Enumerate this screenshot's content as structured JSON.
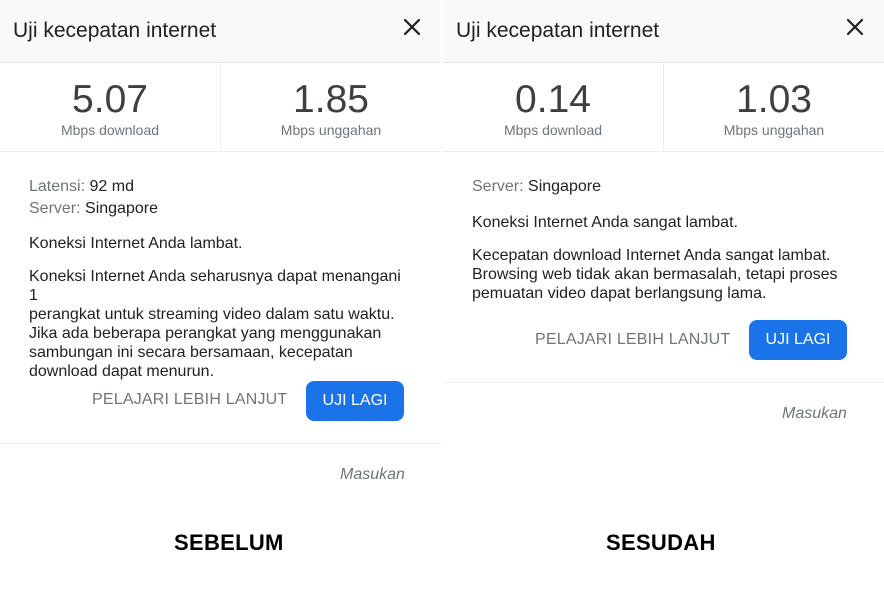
{
  "before": {
    "title": "Uji kecepatan internet",
    "close_icon": "close-icon",
    "download_value": "5.07",
    "download_unit": "Mbps download",
    "upload_value": "1.85",
    "upload_unit": "Mbps unggahan",
    "latency_label": "Latensi:",
    "latency_value": "92 md",
    "server_label": "Server:",
    "server_value": "Singapore",
    "summary": "Koneksi Internet Anda lambat.",
    "details": [
      "Koneksi Internet Anda seharusnya dapat menangani 1",
      "perangkat untuk streaming video dalam satu waktu.",
      "Jika ada beberapa perangkat yang menggunakan",
      "sambungan ini secara bersamaan, kecepatan",
      "download dapat menurun."
    ],
    "learn_more": "PELAJARI LEBIH LANJUT",
    "retry": "UJI LAGI",
    "feedback": "Masukan",
    "caption": "SEBELUM"
  },
  "after": {
    "title": "Uji kecepatan internet",
    "close_icon": "close-icon",
    "download_value": "0.14",
    "download_unit": "Mbps download",
    "upload_value": "1.03",
    "upload_unit": "Mbps unggahan",
    "server_label": "Server:",
    "server_value": "Singapore",
    "summary": "Koneksi Internet Anda sangat lambat.",
    "details": [
      "Kecepatan download Internet Anda sangat lambat.",
      "Browsing web tidak akan bermasalah, tetapi proses",
      "pemuatan video dapat berlangsung lama."
    ],
    "learn_more": "PELAJARI LEBIH LANJUT",
    "retry": "UJI LAGI",
    "feedback": "Masukan",
    "caption": "SESUDAH"
  },
  "colors": {
    "accent": "#1a73e8",
    "header_bg": "#f8f9fa",
    "muted_text": "#70757a"
  }
}
